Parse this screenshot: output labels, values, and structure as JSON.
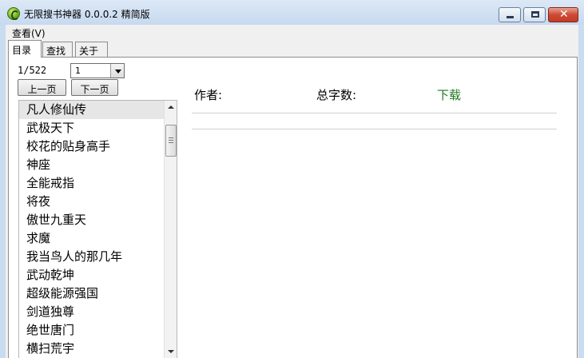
{
  "window": {
    "title": "无限搜书神器 0.0.0.2 精简版",
    "controls": {
      "minimize": "",
      "maximize": "",
      "close": "✕"
    }
  },
  "menu": {
    "view": "查看(V)"
  },
  "tabs": [
    {
      "label": "目录",
      "active": true
    },
    {
      "label": "查找",
      "active": false
    },
    {
      "label": "关于",
      "active": false
    }
  ],
  "pager": {
    "indicator": "1/522",
    "selected_page": "1",
    "prev_label": "上一页",
    "next_label": "下一页"
  },
  "books": [
    "凡人修仙传",
    "武极天下",
    "校花的贴身高手",
    "神座",
    "全能戒指",
    "将夜",
    "傲世九重天",
    "求魔",
    "我当鸟人的那几年",
    "武动乾坤",
    "超级能源强国",
    "剑道独尊",
    "绝世唐门",
    "横扫荒宇"
  ],
  "detail": {
    "author_label": "作者:",
    "word_count_label": "总字数:",
    "download_label": "下载"
  },
  "colors": {
    "download_link": "#1e7a1e",
    "title_bar": "#c6d9ef",
    "close_button": "#c13c25"
  }
}
